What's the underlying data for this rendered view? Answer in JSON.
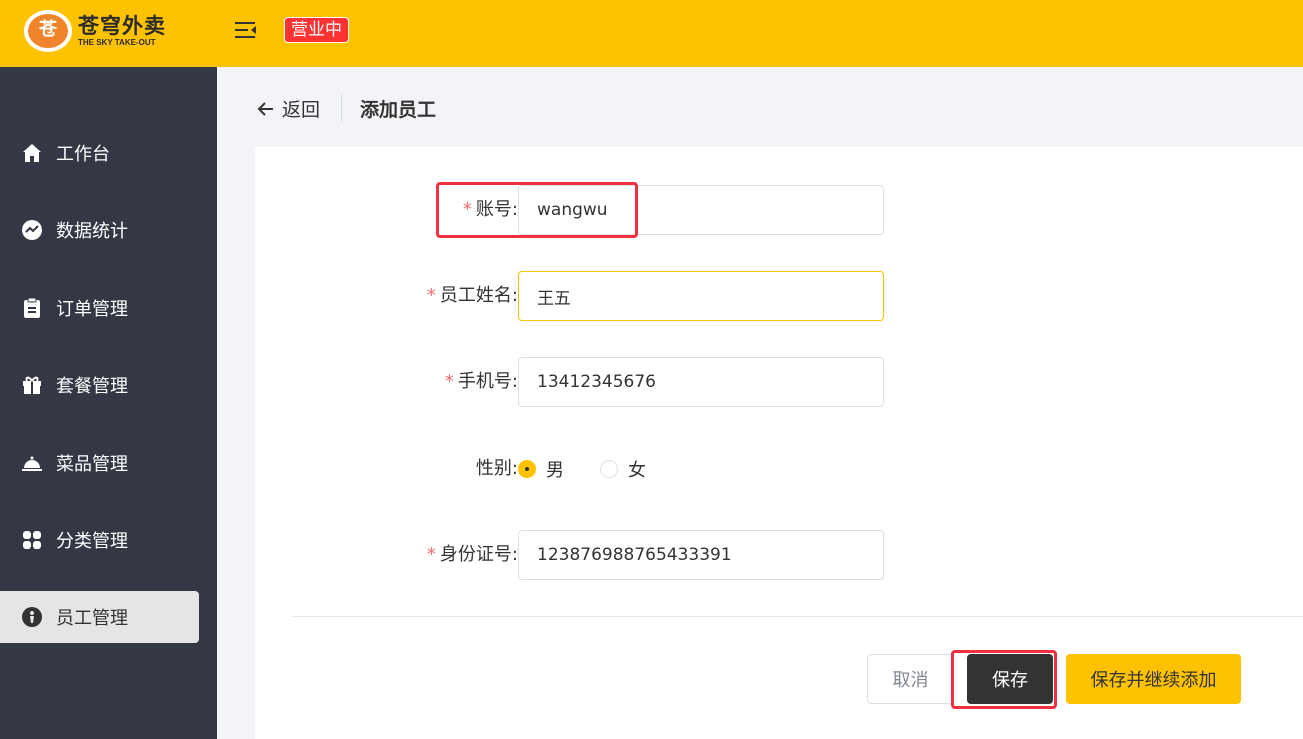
{
  "header": {
    "logo_mark": "苍",
    "logo_cn": "苍穹外卖",
    "logo_en": "THE SKY TAKE-OUT",
    "status_badge": "营业中",
    "accent_color": "#ffc200"
  },
  "sidebar": {
    "items": [
      {
        "label": "工作台",
        "icon": "home-icon"
      },
      {
        "label": "数据统计",
        "icon": "chart-icon"
      },
      {
        "label": "订单管理",
        "icon": "clipboard-icon"
      },
      {
        "label": "套餐管理",
        "icon": "gift-icon"
      },
      {
        "label": "菜品管理",
        "icon": "cloche-icon"
      },
      {
        "label": "分类管理",
        "icon": "grid-icon"
      },
      {
        "label": "员工管理",
        "icon": "employee-icon",
        "active": true
      }
    ]
  },
  "breadcrumb": {
    "back_label": "返回",
    "title": "添加员工"
  },
  "form": {
    "account": {
      "label": "账号:",
      "value": "wangwu"
    },
    "name": {
      "label": "员工姓名:",
      "value": "王五"
    },
    "phone": {
      "label": "手机号:",
      "value": "13412345676"
    },
    "gender": {
      "label": "性别:",
      "options": [
        "男",
        "女"
      ],
      "selected": "男"
    },
    "id_number": {
      "label": "身份证号:",
      "value": "123876988765433391"
    }
  },
  "buttons": {
    "cancel": "取消",
    "save": "保存",
    "save_and_add": "保存并继续添加"
  }
}
